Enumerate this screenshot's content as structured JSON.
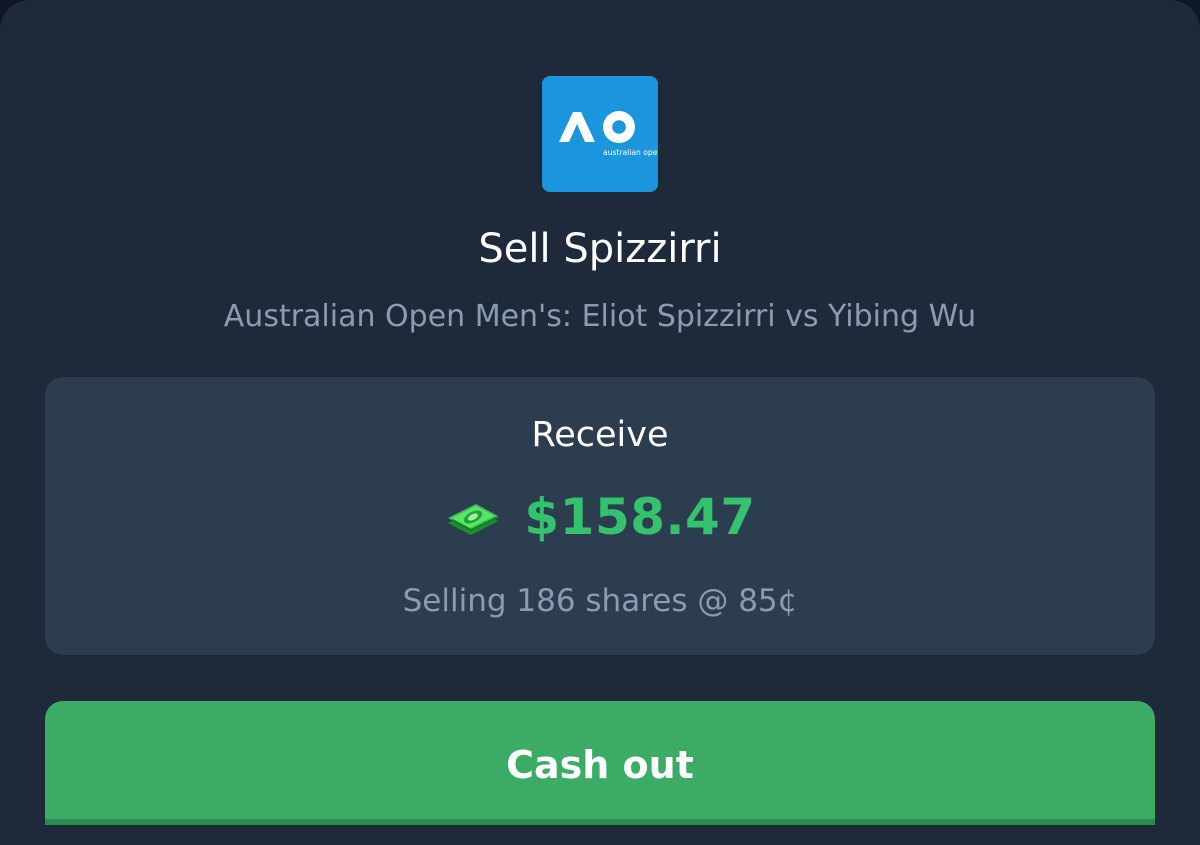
{
  "header": {
    "logo_text": "AO",
    "logo_subtext": "australian open",
    "title": "Sell Spizzirri",
    "subtitle": "Australian Open Men's: Eliot Spizzirri vs Yibing Wu"
  },
  "receive": {
    "label": "Receive",
    "icon": "money-icon",
    "amount": "$158.47",
    "details": "Selling 186 shares @ 85¢"
  },
  "actions": {
    "cash_out_label": "Cash out"
  },
  "colors": {
    "background": "#1e2939",
    "card": "#2d3d50",
    "logo": "#1b95dd",
    "amount": "#35c26f",
    "button": "#3bab65",
    "muted_text": "#8a9bb2"
  }
}
